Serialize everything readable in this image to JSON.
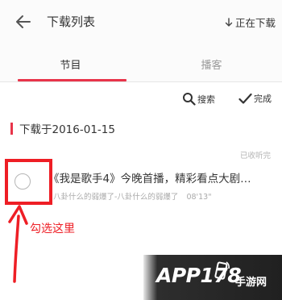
{
  "header": {
    "title": "下载列表",
    "downloading_label": "正在下载"
  },
  "tabs": [
    {
      "label": "节目",
      "active": true
    },
    {
      "label": "播客",
      "active": false
    }
  ],
  "actions": {
    "search_label": "搜索",
    "done_label": "完成"
  },
  "group": {
    "date_label": "下载于2016-01-15"
  },
  "episode": {
    "status": "已收听完",
    "title": "《我是歌手4》今晚首播，精彩看点大剧…",
    "subtitle": "八卦什么的弱爆了-八卦什么的弱爆了",
    "duration": "08'13\""
  },
  "annotation": {
    "label": "勾选这里"
  },
  "watermark": {
    "logo": "APP178",
    "site": "手游网"
  },
  "colors": {
    "accent": "#e8344a",
    "annotation_red": "#ee1e25"
  }
}
